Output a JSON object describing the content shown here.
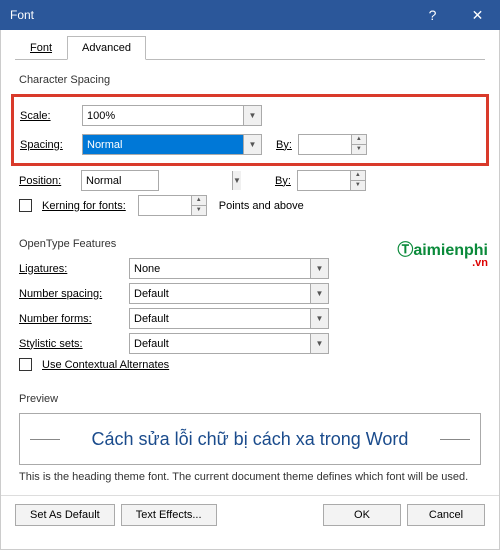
{
  "titlebar": {
    "title": "Font",
    "help": "?",
    "close": "✕"
  },
  "tabs": {
    "font": "Font",
    "advanced": "Advanced"
  },
  "charSpacing": {
    "title": "Character Spacing",
    "scale_label": "Scale:",
    "scale_value": "100%",
    "spacing_label": "Spacing:",
    "spacing_value": "Normal",
    "by1_label": "By:",
    "by1_value": "",
    "position_label": "Position:",
    "position_value": "Normal",
    "by2_label": "By:",
    "by2_value": "",
    "kerning_label": "Kerning for fonts:",
    "kerning_value": "",
    "points_label": "Points and above"
  },
  "openType": {
    "title": "OpenType Features",
    "ligatures_label": "Ligatures:",
    "ligatures_value": "None",
    "numspacing_label": "Number spacing:",
    "numspacing_value": "Default",
    "numforms_label": "Number forms:",
    "numforms_value": "Default",
    "stylistic_label": "Stylistic sets:",
    "stylistic_value": "Default",
    "contextual_label": "Use Contextual Alternates"
  },
  "preview": {
    "title": "Preview",
    "text": "Cách sửa lỗi chữ bị cách xa trong Word",
    "note": "This is the heading theme font. The current document theme defines which font will be used."
  },
  "buttons": {
    "default": "Set As Default",
    "effects": "Text Effects...",
    "ok": "OK",
    "cancel": "Cancel"
  },
  "watermark": {
    "t": "Ⓣaimienphi",
    "vn": ".vn"
  }
}
